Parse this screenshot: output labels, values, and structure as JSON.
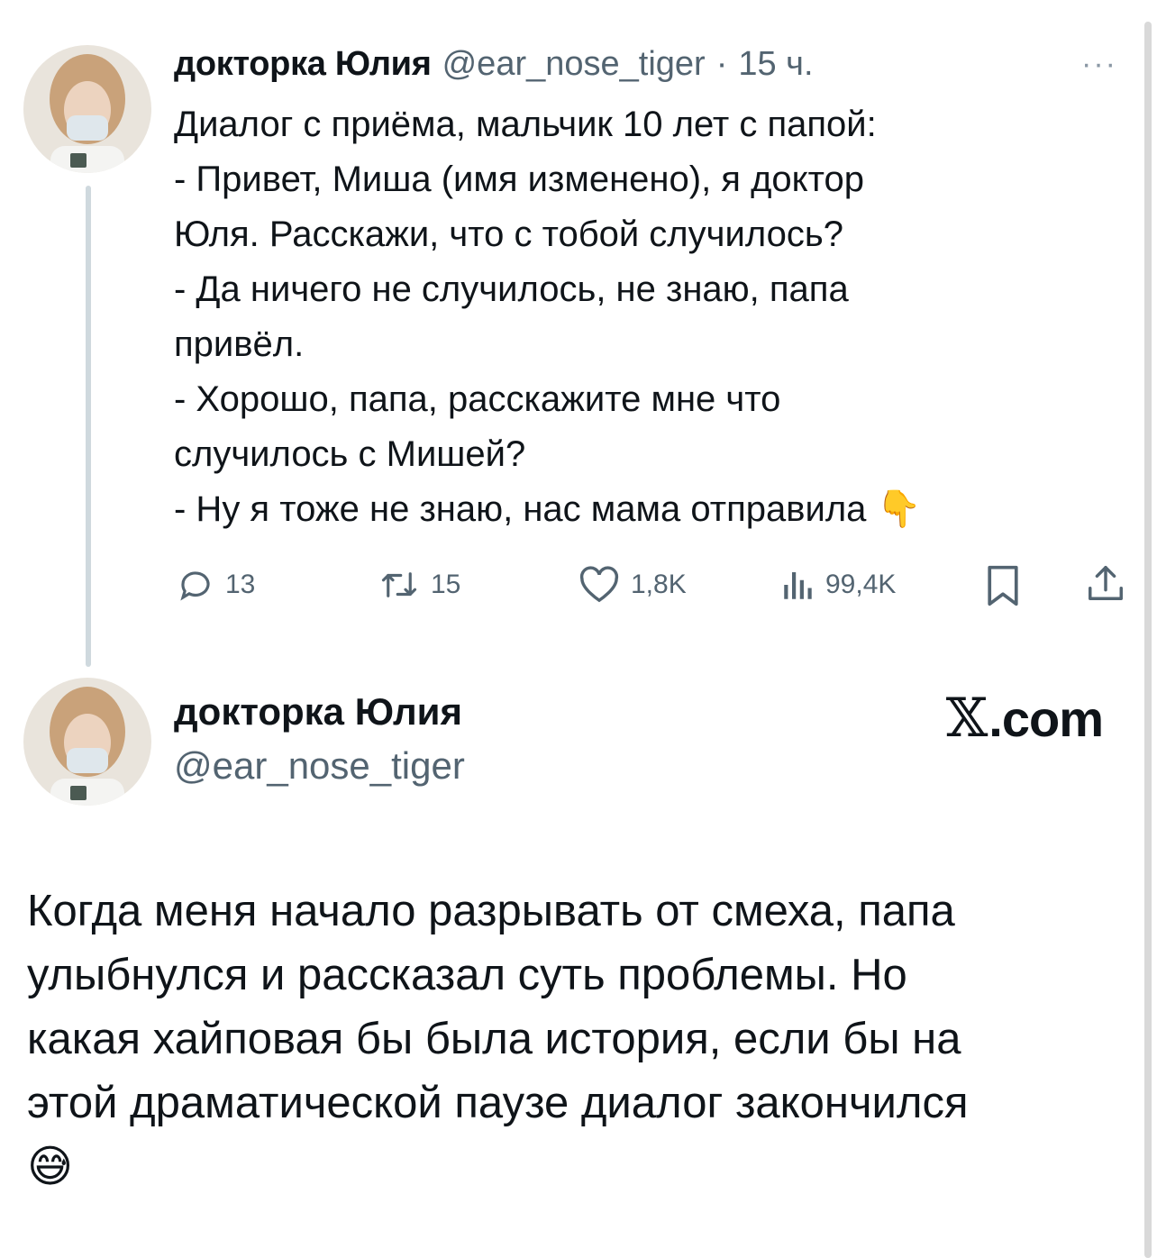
{
  "tweet": {
    "author_name": "докторка Юлия",
    "handle": "@ear_nose_tiger",
    "separator": "·",
    "time": "15 ч.",
    "more_label": "···",
    "text": "Диалог с приёма, мальчик 10 лет с папой:\n- Привет, Миша (имя изменено), я доктор\nЮля. Расскажи, что с тобой случилось?\n- Да ничего не случилось, не знаю, папа\nпривёл.\n- Хорошо, папа, расскажите мне что\nслучилось с Мишей?\n- Ну я тоже не знаю, нас мама отправила",
    "emoji": "👇",
    "actions": {
      "replies": "13",
      "reposts": "15",
      "likes": "1,8K",
      "views": "99,4K"
    },
    "icons": [
      "reply-icon",
      "repost-icon",
      "like-icon",
      "views-icon",
      "bookmark-icon",
      "share-icon"
    ]
  },
  "reply": {
    "author_name": "докторка Юлия",
    "handle": "@ear_nose_tiger",
    "brand": ".com",
    "brand_x": "𝕏",
    "text": "Когда меня начало разрывать от смеха, папа\nулыбнулся и рассказал суть проблемы. Но\nкакая хайповая бы была история, если бы на\nэтой драматической паузе диалог закончился",
    "emoji": "😅"
  },
  "colors": {
    "text": "#0f1419",
    "secondary": "#536471",
    "thread_line": "#cfd9de"
  }
}
